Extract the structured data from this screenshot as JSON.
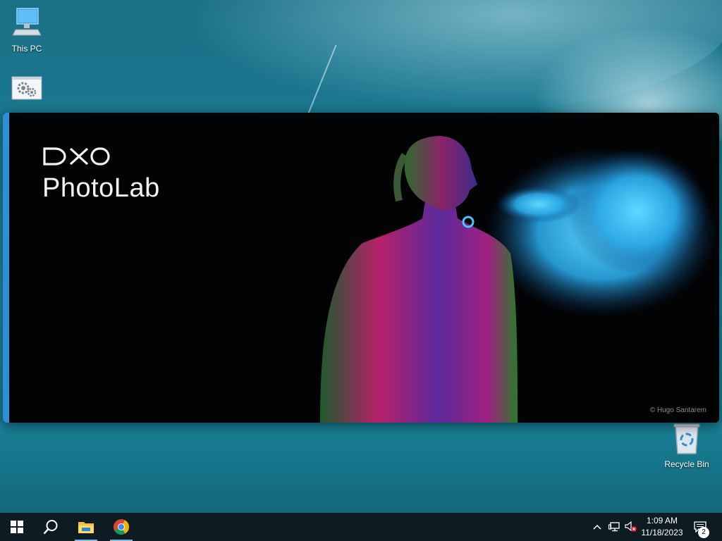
{
  "desktop": {
    "icons": [
      {
        "label": "This PC"
      },
      {
        "label": ""
      },
      {
        "label": "Recycle Bin"
      }
    ]
  },
  "splash": {
    "brand": "DXO",
    "product": "PhotoLab",
    "photo_credit": "© Hugo Santarem",
    "accent_color": "#2d8fd4"
  },
  "taskbar": {
    "start_icon": "windows-start-icon",
    "search_icon": "search-icon",
    "apps": [
      {
        "name": "file-explorer-icon"
      },
      {
        "name": "chrome-icon"
      }
    ],
    "tray": {
      "time": "1:09 AM",
      "date": "11/18/2023",
      "notification_count": "2"
    }
  }
}
